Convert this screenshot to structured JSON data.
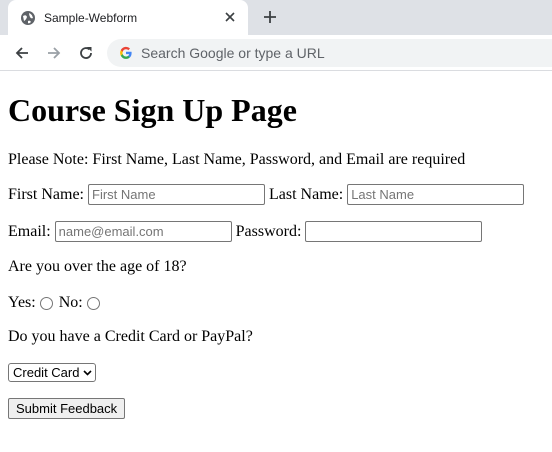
{
  "browser": {
    "tab_title": "Sample-Webform",
    "omnibox_placeholder": "Search Google or type a URL"
  },
  "page": {
    "title": "Course Sign Up Page",
    "note": "Please Note: First Name, Last Name, Password, and Email are required",
    "first_name_label": "First Name:",
    "first_name_placeholder": "First Name",
    "last_name_label": "Last Name:",
    "last_name_placeholder": "Last Name",
    "email_label": "Email:",
    "email_placeholder": "name@email.com",
    "password_label": "Password:",
    "age_question": "Are you over the age of 18?",
    "yes_label": "Yes:",
    "no_label": "No:",
    "payment_question": "Do you have a Credit Card or PayPal?",
    "payment_selected": "Credit Card",
    "submit_label": "Submit Feedback"
  },
  "icons": {
    "tab_favicon": "globe-icon",
    "tab_close": "close-icon",
    "new_tab": "plus-icon",
    "back": "arrow-left-icon",
    "forward": "arrow-right-icon",
    "reload": "reload-icon",
    "omnibox": "google-g-icon",
    "select": "chevron-down-icon"
  }
}
